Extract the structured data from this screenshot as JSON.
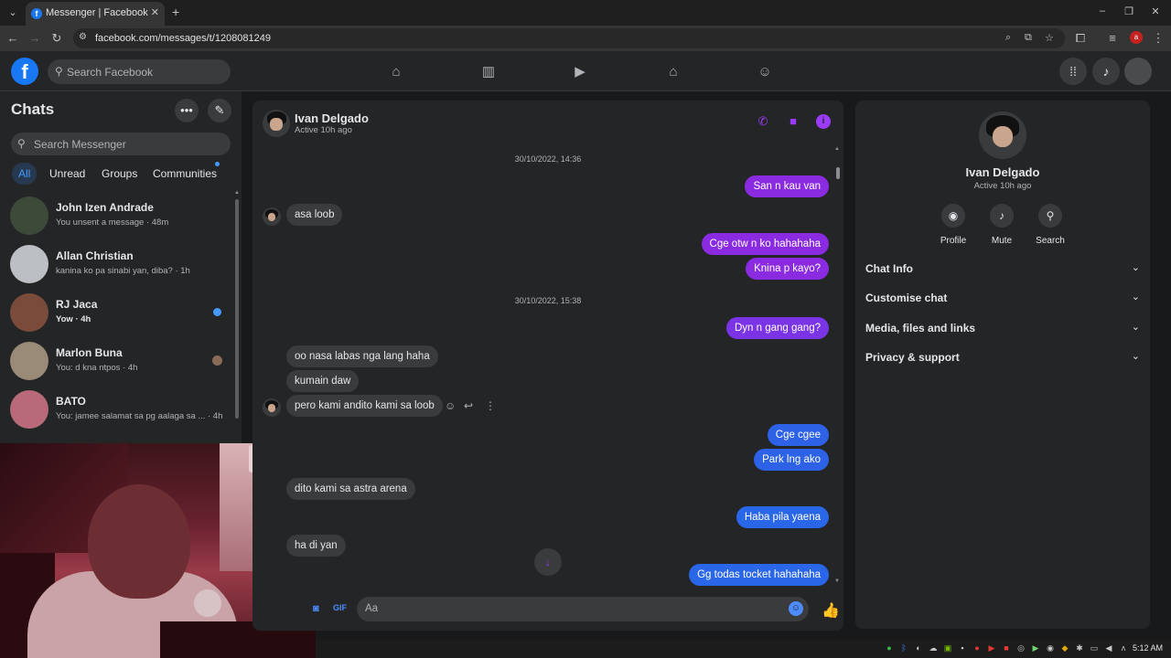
{
  "browser": {
    "tab_title": "Messenger | Facebook",
    "url": "facebook.com/messages/t/1208081249",
    "profile_initial": "a"
  },
  "facebook": {
    "search_placeholder": "Search Facebook",
    "nav_icons": [
      "home-icon",
      "chart-icon",
      "video-icon",
      "marketplace-icon",
      "groups-icon"
    ]
  },
  "sidebar": {
    "title": "Chats",
    "search_placeholder": "Search Messenger",
    "filters": [
      "All",
      "Unread",
      "Groups",
      "Communities"
    ],
    "active_filter": "All",
    "chats": [
      {
        "name": "John Izen Andrade",
        "preview": "You unsent a message · 48m",
        "avatar_color": "#3d4a3a"
      },
      {
        "name": "Allan Christian",
        "preview": "kanina ko pa sinabi yan, diba? · 1h",
        "avatar_color": "#bcc0c4"
      },
      {
        "name": "RJ Jaca",
        "preview": "Yow · 4h",
        "unread": true,
        "avatar_color": "#7a4b3a"
      },
      {
        "name": "Marlon Buna",
        "preview": "You: d kna ntpos · 4h",
        "avatar_color": "#9a8a78"
      },
      {
        "name": "BATO",
        "preview": "You: jamee salamat sa pg aalaga sa ... · 4h",
        "avatar_color": "#b86a7a"
      }
    ]
  },
  "conversation": {
    "contact_name": "Ivan Delgado",
    "status": "Active 10h ago",
    "composer_placeholder": "Aa",
    "messages": [
      {
        "type": "timestamp",
        "text": "30/10/2022, 14:36"
      },
      {
        "type": "out",
        "text": "San n kau van"
      },
      {
        "type": "in",
        "text": "asa loob"
      },
      {
        "type": "out",
        "text": "Cge otw n ko hahahaha"
      },
      {
        "type": "out",
        "text": "Knina p kayo?"
      },
      {
        "type": "timestamp",
        "text": "30/10/2022, 15:38"
      },
      {
        "type": "out",
        "text": "Dyn n gang gang?"
      },
      {
        "type": "in",
        "text": "oo nasa labas nga lang haha"
      },
      {
        "type": "in",
        "text": "kumain daw"
      },
      {
        "type": "in",
        "text": "pero kami andito kami sa loob"
      },
      {
        "type": "out",
        "text": "Cge cgee"
      },
      {
        "type": "out",
        "text": "Park lng ako"
      },
      {
        "type": "in",
        "text": "dito kami sa astra arena"
      },
      {
        "type": "out",
        "text": "Haba pila yaena"
      },
      {
        "type": "in",
        "text": "ha di yan"
      },
      {
        "type": "out",
        "text": "Gg todas tocket hahahaha"
      }
    ]
  },
  "info_panel": {
    "name": "Ivan Delgado",
    "status": "Active 10h ago",
    "actions": [
      "Profile",
      "Mute",
      "Search"
    ],
    "sections": [
      "Chat Info",
      "Customise chat",
      "Media, files and links",
      "Privacy & support"
    ]
  },
  "taskbar": {
    "time": "5:12 AM"
  },
  "colors": {
    "accent_purple": "#9b3bf8",
    "bubble_purple": "#8a2be2",
    "bubble_blue": "#2966e8",
    "unread_blue": "#4599ff"
  }
}
